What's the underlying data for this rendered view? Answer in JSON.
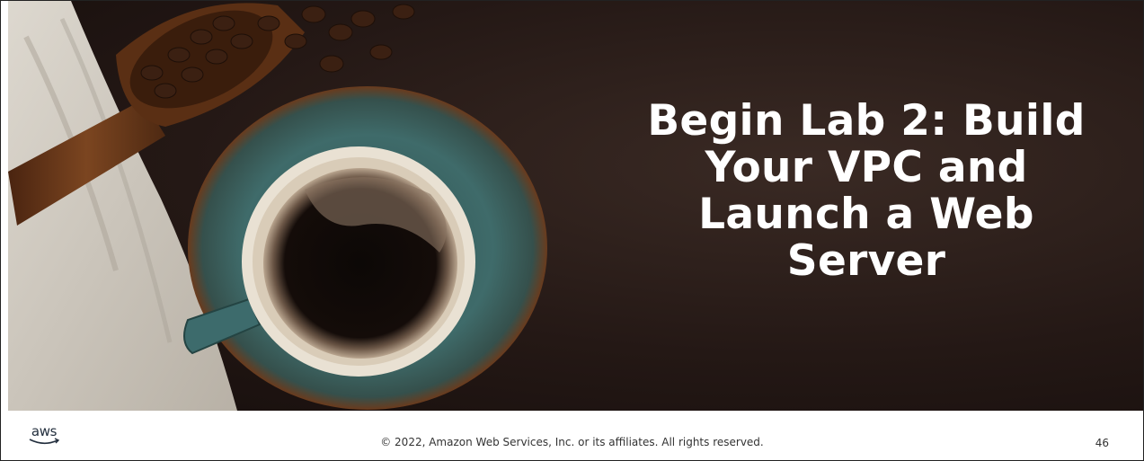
{
  "slide": {
    "title": "Begin Lab 2: Build Your VPC and Launch a Web Server",
    "footer": {
      "logo_text": "aws",
      "copyright": "© 2022, Amazon Web Services, Inc. or its affiliates. All rights reserved.",
      "page_number": "46"
    }
  },
  "colors": {
    "background": "#241815",
    "title_text": "#ffffff",
    "saucer": "#3f6b6a",
    "coffee": "#0e0a08",
    "scoop_wood": "#6b3a1c",
    "cloth": "#cfc9bf"
  }
}
